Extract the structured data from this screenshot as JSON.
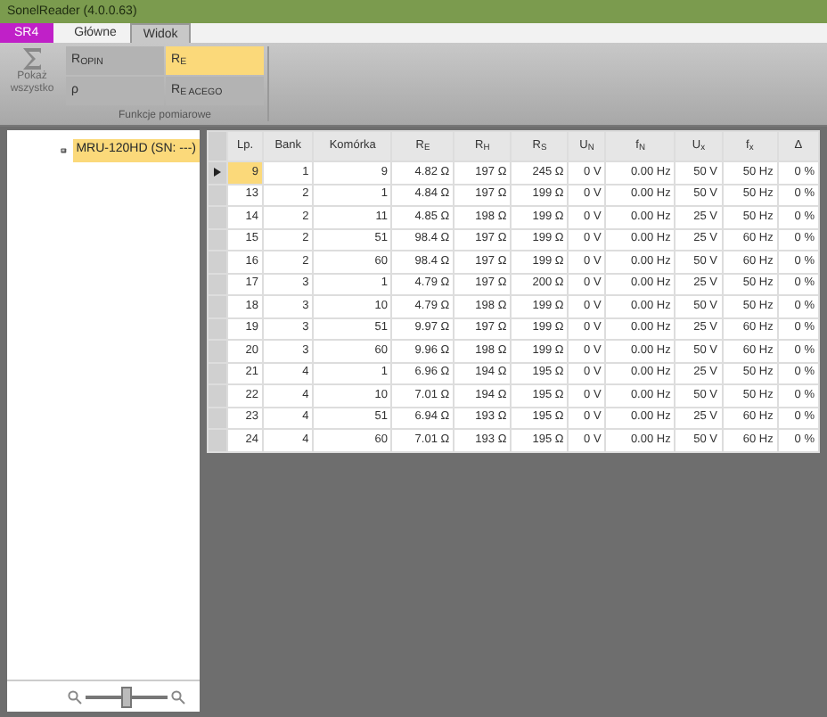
{
  "window": {
    "title": "SonelReader (4.0.0.63)"
  },
  "tabs": [
    {
      "label": "SR4",
      "kind": "app",
      "selected": false
    },
    {
      "label": "Główne",
      "kind": "tab",
      "selected": false
    },
    {
      "label": "Widok",
      "kind": "tab",
      "selected": true
    }
  ],
  "ribbon": {
    "show_all": "Pokaż wszystko",
    "group_label": "Funkcje pomiarowe",
    "functions": [
      {
        "label": "R$_{OPIN}$",
        "selected": false
      },
      {
        "label": "R$_{E}$",
        "selected": true
      },
      {
        "label": "ρ",
        "selected": false
      },
      {
        "label": "R$_{E ACEGO}$",
        "selected": false
      }
    ]
  },
  "tree": {
    "items": [
      {
        "label": "MRU-120HD (SN: ---)",
        "selected": true
      }
    ]
  },
  "zoom": {
    "level": 0.5
  },
  "table": {
    "columns": [
      "Lp.",
      "Bank",
      "Komórka",
      "R$_{E}$",
      "R$_{H}$",
      "R$_{S}$",
      "U$_{N}$",
      "f$_{N}$",
      "U$_{x}$",
      "f$_{x}$",
      "Δ"
    ],
    "rows": [
      {
        "selected": true,
        "cells": [
          "9",
          "1",
          "9",
          "4.82 Ω",
          "197 Ω",
          "245 Ω",
          "0 V",
          "0.00 Hz",
          "50 V",
          "50 Hz",
          "0 %"
        ]
      },
      {
        "selected": false,
        "cells": [
          "13",
          "2",
          "1",
          "4.84 Ω",
          "197 Ω",
          "199 Ω",
          "0 V",
          "0.00 Hz",
          "50 V",
          "50 Hz",
          "0 %"
        ]
      },
      {
        "selected": false,
        "cells": [
          "14",
          "2",
          "11",
          "4.85 Ω",
          "198 Ω",
          "199 Ω",
          "0 V",
          "0.00 Hz",
          "25 V",
          "50 Hz",
          "0 %"
        ]
      },
      {
        "selected": false,
        "cells": [
          "15",
          "2",
          "51",
          "98.4 Ω",
          "197 Ω",
          "199 Ω",
          "0 V",
          "0.00 Hz",
          "25 V",
          "60 Hz",
          "0 %"
        ]
      },
      {
        "selected": false,
        "cells": [
          "16",
          "2",
          "60",
          "98.4 Ω",
          "197 Ω",
          "199 Ω",
          "0 V",
          "0.00 Hz",
          "50 V",
          "60 Hz",
          "0 %"
        ]
      },
      {
        "selected": false,
        "cells": [
          "17",
          "3",
          "1",
          "4.79 Ω",
          "197 Ω",
          "200 Ω",
          "0 V",
          "0.00 Hz",
          "25 V",
          "50 Hz",
          "0 %"
        ]
      },
      {
        "selected": false,
        "cells": [
          "18",
          "3",
          "10",
          "4.79 Ω",
          "198 Ω",
          "199 Ω",
          "0 V",
          "0.00 Hz",
          "50 V",
          "50 Hz",
          "0 %"
        ]
      },
      {
        "selected": false,
        "cells": [
          "19",
          "3",
          "51",
          "9.97 Ω",
          "197 Ω",
          "199 Ω",
          "0 V",
          "0.00 Hz",
          "25 V",
          "60 Hz",
          "0 %"
        ]
      },
      {
        "selected": false,
        "cells": [
          "20",
          "3",
          "60",
          "9.96 Ω",
          "198 Ω",
          "199 Ω",
          "0 V",
          "0.00 Hz",
          "50 V",
          "60 Hz",
          "0 %"
        ]
      },
      {
        "selected": false,
        "cells": [
          "21",
          "4",
          "1",
          "6.96 Ω",
          "194 Ω",
          "195 Ω",
          "0 V",
          "0.00 Hz",
          "25 V",
          "50 Hz",
          "0 %"
        ]
      },
      {
        "selected": false,
        "cells": [
          "22",
          "4",
          "10",
          "7.01 Ω",
          "194 Ω",
          "195 Ω",
          "0 V",
          "0.00 Hz",
          "50 V",
          "50 Hz",
          "0 %"
        ]
      },
      {
        "selected": false,
        "cells": [
          "23",
          "4",
          "51",
          "6.94 Ω",
          "193 Ω",
          "195 Ω",
          "0 V",
          "0.00 Hz",
          "25 V",
          "60 Hz",
          "0 %"
        ]
      },
      {
        "selected": false,
        "cells": [
          "24",
          "4",
          "60",
          "7.01 Ω",
          "193 Ω",
          "195 Ω",
          "0 V",
          "0.00 Hz",
          "50 V",
          "60 Hz",
          "0 %"
        ]
      }
    ]
  }
}
